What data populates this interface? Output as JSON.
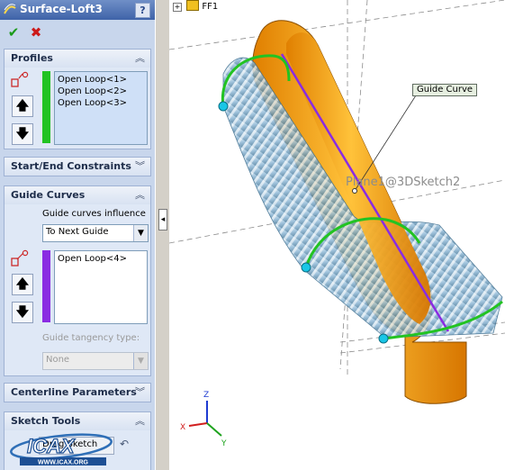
{
  "panel": {
    "title": "Surface-Loft3",
    "help_label": "?",
    "ok_icon": "check-icon",
    "cancel_icon": "x-icon",
    "sections": {
      "profiles": {
        "label": "Profiles",
        "items": [
          "Open Loop<1>",
          "Open Loop<2>",
          "Open Loop<3>"
        ],
        "color": "#22c322"
      },
      "start_end": {
        "label": "Start/End Constraints"
      },
      "guide_curves": {
        "label": "Guide Curves",
        "influence_label": "Guide curves influence",
        "influence_value": "To Next Guide",
        "items": [
          "Open Loop<4>"
        ],
        "color": "#8a2be2",
        "tangency_label": "Guide tangency type:",
        "tangency_value": "None"
      },
      "centerline": {
        "label": "Centerline Parameters"
      },
      "sketch_tools": {
        "label": "Sketch Tools",
        "drag_label": "Drag Sketch"
      }
    },
    "logo_text": "ICAX",
    "logo_url": "WWW.ICAX.ORG"
  },
  "viewport": {
    "tree_node": "FF1",
    "callout": "Guide Curve",
    "sketch_label": "Plane1@3DSketch2",
    "triad": {
      "x": "X",
      "y": "Y",
      "z": "Z"
    }
  },
  "colors": {
    "body_orange": "#f5a623",
    "surface_blue": "#8fb8d6",
    "profile_green": "#22c322",
    "guide_purple": "#8a2be2",
    "point_cyan": "#19c6e6"
  }
}
